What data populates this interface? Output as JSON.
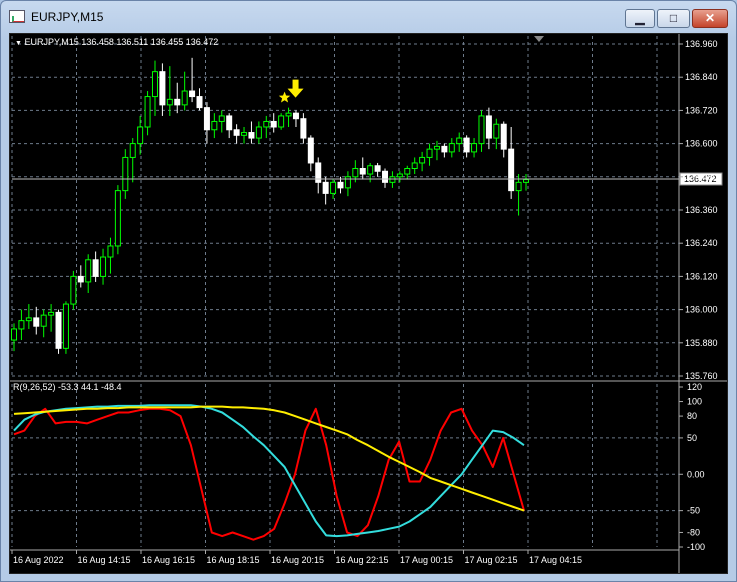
{
  "window": {
    "title": "EURJPY,M15",
    "minimize_glyph": "▁",
    "maximize_glyph": "□",
    "close_glyph": "✕"
  },
  "chart_header": {
    "dropdown_glyph": "▼",
    "text": "EURJPY,M15  136.458 136.511 136.455 136.472"
  },
  "indicator_header": "R(9,26,52) -53.3 44.1 -48.4",
  "colors": {
    "background": "#000000",
    "grid": "#6e7b8b",
    "bull": "#00ff00",
    "bear": "#ffffff",
    "series_red": "#ff0000",
    "series_cyan": "#33dddd",
    "series_yellow": "#ffee00",
    "arrow": "#ffee00"
  },
  "icons": [
    "app-chart-icon",
    "down-arrow-icon",
    "star-icon",
    "dropdown-triangle-icon"
  ],
  "chart_data": [
    {
      "type": "candlestick",
      "symbol": "EURJPY",
      "timeframe": "M15",
      "ylim": [
        135.76,
        136.96
      ],
      "y_ticks": [
        "136.960",
        "136.840",
        "136.720",
        "136.600",
        "136.480",
        "136.360",
        "136.240",
        "136.120",
        "136.000",
        "135.880",
        "135.760"
      ],
      "current_price": "136.472",
      "x_ticks": [
        "16 Aug 2022",
        "16 Aug 14:15",
        "16 Aug 16:15",
        "16 Aug 18:15",
        "16 Aug 20:15",
        "16 Aug 22:15",
        "17 Aug 00:15",
        "17 Aug 02:15",
        "17 Aug 04:15"
      ],
      "candles": [
        [
          135.89,
          135.95,
          135.85,
          135.93
        ],
        [
          135.93,
          136.0,
          135.89,
          135.96
        ],
        [
          135.96,
          136.02,
          135.93,
          135.97
        ],
        [
          135.97,
          136.01,
          135.91,
          135.94
        ],
        [
          135.94,
          136.0,
          135.9,
          135.98
        ],
        [
          135.98,
          136.02,
          135.92,
          135.99
        ],
        [
          135.99,
          136.0,
          135.84,
          135.86
        ],
        [
          135.86,
          136.03,
          135.84,
          136.02
        ],
        [
          136.02,
          136.14,
          136.0,
          136.12
        ],
        [
          136.12,
          136.16,
          136.08,
          136.1
        ],
        [
          136.1,
          136.2,
          136.06,
          136.18
        ],
        [
          136.18,
          136.21,
          136.1,
          136.12
        ],
        [
          136.12,
          136.22,
          136.09,
          136.19
        ],
        [
          136.19,
          136.26,
          136.13,
          136.23
        ],
        [
          136.23,
          136.45,
          136.2,
          136.43
        ],
        [
          136.43,
          136.58,
          136.4,
          136.55
        ],
        [
          136.55,
          136.62,
          136.46,
          136.6
        ],
        [
          136.6,
          136.7,
          136.56,
          136.66
        ],
        [
          136.66,
          136.79,
          136.63,
          136.77
        ],
        [
          136.77,
          136.9,
          136.7,
          136.86
        ],
        [
          136.86,
          136.89,
          136.7,
          136.74
        ],
        [
          136.74,
          136.88,
          136.7,
          136.76
        ],
        [
          136.76,
          136.82,
          136.71,
          136.74
        ],
        [
          136.74,
          136.86,
          136.72,
          136.79
        ],
        [
          136.79,
          136.91,
          136.75,
          136.77
        ],
        [
          136.77,
          136.8,
          136.72,
          136.73
        ],
        [
          136.73,
          136.75,
          136.6,
          136.65
        ],
        [
          136.65,
          136.71,
          136.62,
          136.68
        ],
        [
          136.68,
          136.72,
          136.64,
          136.7
        ],
        [
          136.7,
          136.71,
          136.62,
          136.65
        ],
        [
          136.65,
          136.67,
          136.6,
          136.63
        ],
        [
          136.63,
          136.66,
          136.6,
          136.64
        ],
        [
          136.64,
          136.68,
          136.6,
          136.62
        ],
        [
          136.62,
          136.68,
          136.6,
          136.66
        ],
        [
          136.66,
          136.7,
          136.62,
          136.68
        ],
        [
          136.68,
          136.71,
          136.64,
          136.66
        ],
        [
          136.66,
          136.71,
          136.65,
          136.7
        ],
        [
          136.7,
          136.73,
          136.66,
          136.71
        ],
        [
          136.71,
          136.72,
          136.66,
          136.69
        ],
        [
          136.69,
          136.71,
          136.6,
          136.62
        ],
        [
          136.62,
          136.63,
          136.5,
          136.53
        ],
        [
          136.53,
          136.55,
          136.42,
          136.46
        ],
        [
          136.46,
          136.48,
          136.38,
          136.42
        ],
        [
          136.42,
          136.47,
          136.4,
          136.46
        ],
        [
          136.46,
          136.48,
          136.42,
          136.44
        ],
        [
          136.44,
          136.5,
          136.41,
          136.48
        ],
        [
          136.48,
          136.54,
          136.46,
          136.51
        ],
        [
          136.51,
          136.55,
          136.47,
          136.49
        ],
        [
          136.49,
          136.53,
          136.46,
          136.52
        ],
        [
          136.52,
          136.53,
          136.48,
          136.5
        ],
        [
          136.5,
          136.51,
          136.44,
          136.46
        ],
        [
          136.46,
          136.5,
          136.44,
          136.48
        ],
        [
          136.48,
          136.5,
          136.46,
          136.49
        ],
        [
          136.49,
          136.52,
          136.47,
          136.51
        ],
        [
          136.51,
          136.55,
          136.49,
          136.53
        ],
        [
          136.53,
          136.57,
          136.5,
          136.55
        ],
        [
          136.55,
          136.6,
          136.52,
          136.58
        ],
        [
          136.58,
          136.61,
          136.54,
          136.59
        ],
        [
          136.59,
          136.6,
          136.55,
          136.57
        ],
        [
          136.57,
          136.62,
          136.55,
          136.6
        ],
        [
          136.6,
          136.64,
          136.57,
          136.62
        ],
        [
          136.62,
          136.63,
          136.55,
          136.57
        ],
        [
          136.57,
          136.62,
          136.55,
          136.6
        ],
        [
          136.6,
          136.72,
          136.57,
          136.7
        ],
        [
          136.7,
          136.73,
          136.58,
          136.62
        ],
        [
          136.62,
          136.69,
          136.58,
          136.67
        ],
        [
          136.67,
          136.68,
          136.55,
          136.58
        ],
        [
          136.58,
          136.66,
          136.4,
          136.43
        ],
        [
          136.43,
          136.49,
          136.34,
          136.46
        ],
        [
          136.46,
          136.49,
          136.43,
          136.47
        ]
      ],
      "marker": {
        "type": "arrow-down",
        "candle": 37
      }
    },
    {
      "type": "line",
      "title": "R(9,26,52) -53.3 44.1 -48.4",
      "ylim": [
        -100,
        120
      ],
      "y_ticks": [
        "120",
        "100",
        "80",
        "50",
        "0.00",
        "-50",
        "-80",
        "-100"
      ],
      "series": [
        {
          "color": "#ff0000",
          "values": [
            55,
            60,
            80,
            90,
            70,
            72,
            72,
            70,
            75,
            80,
            85,
            85,
            88,
            90,
            90,
            88,
            80,
            40,
            -20,
            -80,
            -85,
            -80,
            -85,
            -90,
            -85,
            -75,
            -40,
            0,
            60,
            90,
            40,
            -30,
            -80,
            -85,
            -70,
            -30,
            20,
            45,
            -10,
            -10,
            20,
            60,
            85,
            90,
            60,
            40,
            10,
            50,
            0,
            -50
          ]
        },
        {
          "color": "#33dddd",
          "values": [
            60,
            75,
            82,
            86,
            88,
            90,
            91,
            92,
            93,
            93,
            94,
            94,
            94,
            95,
            95,
            95,
            95,
            95,
            93,
            90,
            85,
            75,
            65,
            52,
            40,
            25,
            10,
            -15,
            -40,
            -65,
            -84,
            -85,
            -84,
            -82,
            -80,
            -78,
            -75,
            -72,
            -65,
            -55,
            -45,
            -30,
            -15,
            0,
            20,
            40,
            60,
            58,
            50,
            40
          ]
        },
        {
          "color": "#ffee00",
          "values": [
            83,
            84,
            85,
            86,
            87,
            88,
            89,
            90,
            90,
            91,
            91,
            92,
            92,
            92,
            92,
            92,
            92,
            92,
            93,
            93,
            93,
            92,
            92,
            91,
            90,
            88,
            85,
            80,
            75,
            70,
            65,
            60,
            55,
            47,
            40,
            32,
            24,
            17,
            10,
            3,
            -5,
            -10,
            -15,
            -20,
            -25,
            -30,
            -35,
            -40,
            -45,
            -50
          ]
        }
      ]
    }
  ]
}
